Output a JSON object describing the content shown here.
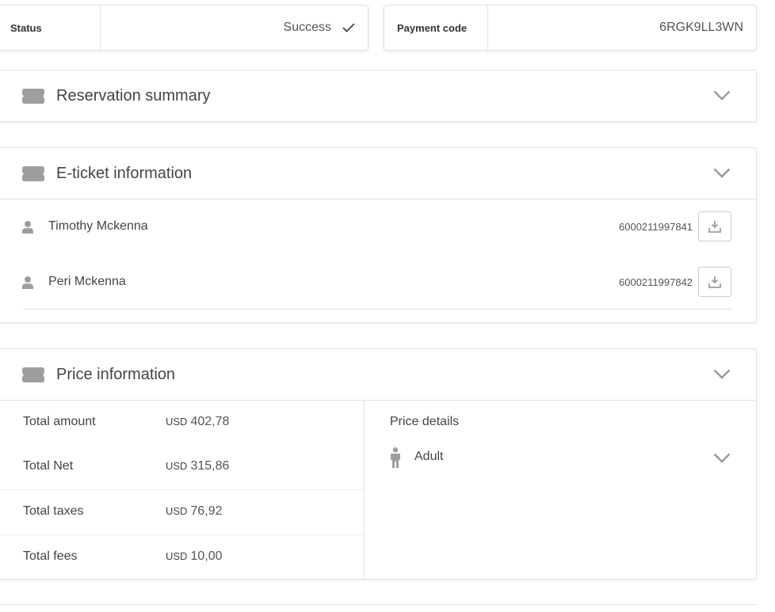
{
  "status": {
    "label": "Status",
    "value": "Success"
  },
  "payment": {
    "label": "Payment code",
    "value": "6RGK9LL3WN"
  },
  "sections": {
    "reservation": {
      "title": "Reservation summary"
    },
    "eticket": {
      "title": "E-ticket information",
      "passengers": [
        {
          "name": "Timothy Mckenna",
          "ticket_number": "6000211997841"
        },
        {
          "name": "Peri Mckenna",
          "ticket_number": "6000211997842"
        }
      ]
    },
    "price": {
      "title": "Price information",
      "rows": [
        {
          "label": "Total amount",
          "currency": "USD",
          "amount": "402,78"
        },
        {
          "label": "Total Net",
          "currency": "USD",
          "amount": "315,86"
        },
        {
          "label": "Total taxes",
          "currency": "USD",
          "amount": "76,92"
        },
        {
          "label": "Total fees",
          "currency": "USD",
          "amount": "10,00"
        }
      ],
      "details_title": "Price details",
      "details_item": "Adult"
    }
  },
  "icons": {
    "ticket": "ticket-icon",
    "chevron": "chevron-down-icon",
    "check": "check-icon",
    "person": "person-icon",
    "download": "download-icon",
    "adult": "adult-icon"
  },
  "colors": {
    "icon_gray": "#999999",
    "border": "#e2e2e2"
  }
}
